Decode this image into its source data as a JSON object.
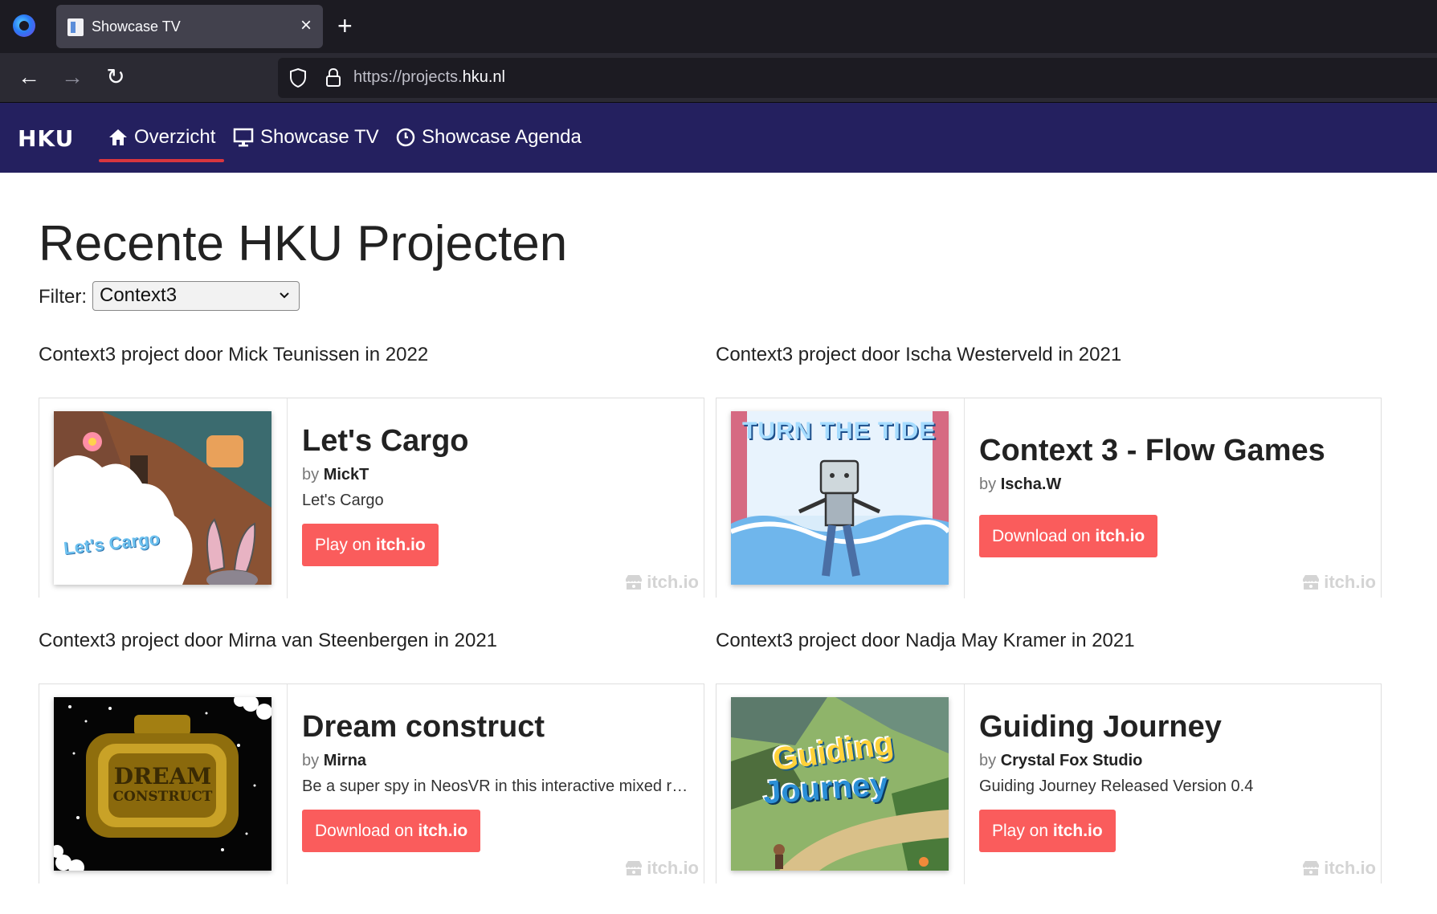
{
  "browser": {
    "tab_title": "Showcase TV",
    "tab_close": "×",
    "new_tab": "+",
    "url_prefix": "https://projects.",
    "url_host": "hku.nl",
    "back": "←",
    "forward": "→",
    "reload": "↻"
  },
  "site": {
    "logo": "HKU",
    "menu": [
      {
        "label": "Overzicht",
        "icon": "home-icon",
        "active": true
      },
      {
        "label": "Showcase TV",
        "icon": "monitor-icon"
      },
      {
        "label": "Showcase Agenda",
        "icon": "clock-icon"
      }
    ],
    "accent": "#d9363e",
    "header_bg": "#24205f"
  },
  "page": {
    "title": "Recente HKU Projecten",
    "filter_label": "Filter:",
    "filter_value": "Context3"
  },
  "projects": [
    {
      "caption": "Context3 project door Mick Teunissen in 2022",
      "title": "Let's Cargo",
      "by_prefix": "by",
      "author": "MickT",
      "desc": "Let's Cargo",
      "button_pre": "Play on ",
      "button_bold": "itch.io",
      "watermark": "itch.io"
    },
    {
      "caption": "Context3 project door Ischa Westerveld in 2021",
      "title": "Context 3 - Flow Games",
      "by_prefix": "by",
      "author": "Ischa.W",
      "desc": "",
      "button_pre": "Download on ",
      "button_bold": "itch.io",
      "watermark": "itch.io"
    },
    {
      "caption": "Context3 project door Mirna van Steenbergen in 2021",
      "title": "Dream construct",
      "by_prefix": "by",
      "author": "Mirna",
      "desc": "Be a super spy in NeosVR in this interactive mixed realit…",
      "button_pre": "Download on ",
      "button_bold": "itch.io",
      "watermark": "itch.io"
    },
    {
      "caption": "Context3 project door Nadja May Kramer in 2021",
      "title": "Guiding Journey",
      "by_prefix": "by",
      "author": "Crystal Fox Studio",
      "desc": "Guiding Journey Released Version 0.4",
      "button_pre": "Play on ",
      "button_bold": "itch.io",
      "watermark": "itch.io"
    }
  ],
  "thumb_text": {
    "cargo": "Let's Cargo",
    "tide": "TURN THE TIDE",
    "dream_1": "DREAM",
    "dream_2": "CONSTRUCT",
    "journey_1": "Guiding",
    "journey_2": "Journey"
  }
}
